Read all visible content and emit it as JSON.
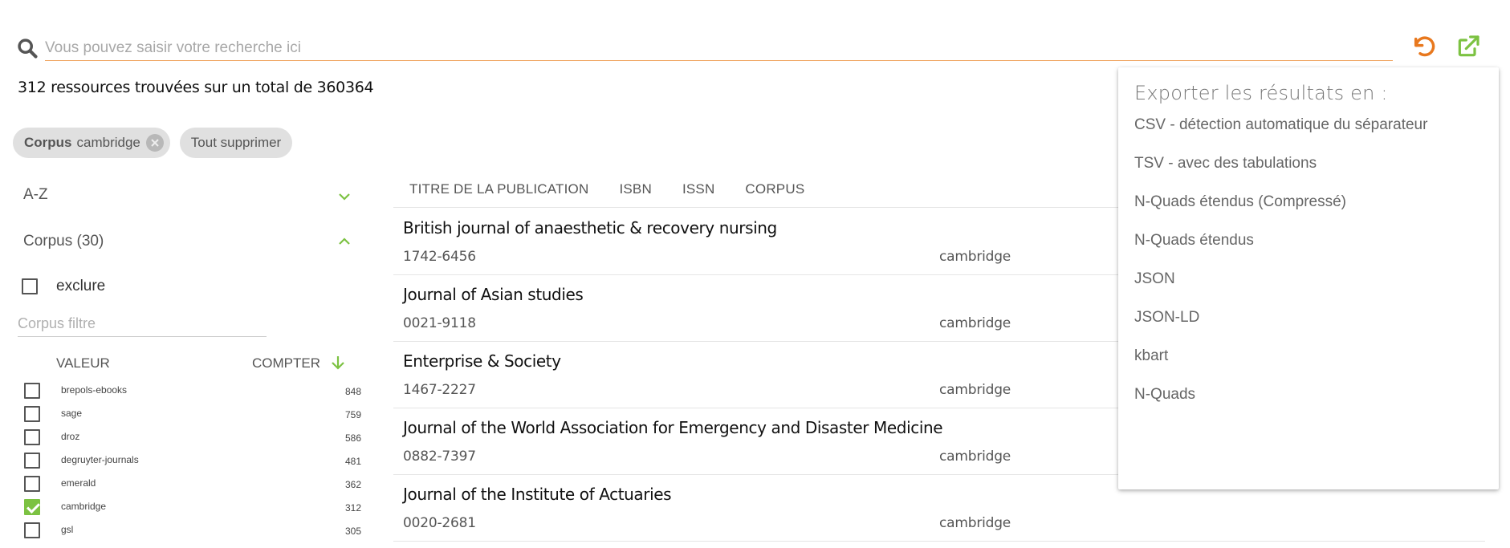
{
  "search": {
    "placeholder": "Vous pouvez saisir votre recherche ici",
    "value": ""
  },
  "results": {
    "count_text": "312 ressources trouvées sur un total de 360364"
  },
  "chips": {
    "corpus_key": "Corpus",
    "corpus_value": "cambridge",
    "clear_all": "Tout supprimer"
  },
  "facets": {
    "az_label": "A-Z",
    "corpus_label": "Corpus (30)",
    "exclude_label": "exclure",
    "filter_placeholder": "Corpus filtre",
    "col_value": "VALEUR",
    "col_count": "COMPTER",
    "items": [
      {
        "name": "brepols-ebooks",
        "count": "848",
        "checked": false
      },
      {
        "name": "sage",
        "count": "759",
        "checked": false
      },
      {
        "name": "droz",
        "count": "586",
        "checked": false
      },
      {
        "name": "degruyter-journals",
        "count": "481",
        "checked": false
      },
      {
        "name": "emerald",
        "count": "362",
        "checked": false
      },
      {
        "name": "cambridge",
        "count": "312",
        "checked": true
      },
      {
        "name": "gsl",
        "count": "305",
        "checked": false
      }
    ]
  },
  "table": {
    "headers": [
      "TITRE DE LA PUBLICATION",
      "ISBN",
      "ISSN",
      "CORPUS"
    ],
    "rows": [
      {
        "title": "British journal of anaesthetic & recovery nursing",
        "issn": "1742-6456",
        "corpus": "cambridge"
      },
      {
        "title": "Journal of Asian studies",
        "issn": "0021-9118",
        "corpus": "cambridge"
      },
      {
        "title": "Enterprise & Society",
        "issn": "1467-2227",
        "corpus": "cambridge"
      },
      {
        "title": "Journal of the World Association for Emergency and Disaster Medicine",
        "issn": "0882-7397",
        "corpus": "cambridge"
      },
      {
        "title": "Journal of the Institute of Actuaries",
        "issn": "0020-2681",
        "corpus": "cambridge"
      }
    ]
  },
  "export_menu": {
    "title": "Exporter les résultats en :",
    "items": [
      "CSV - détection automatique du séparateur",
      "TSV - avec des tabulations",
      "N-Quads étendus (Compressé)",
      "N-Quads étendus",
      "JSON",
      "JSON-LD",
      "kbart",
      "N-Quads"
    ]
  },
  "colors": {
    "accent_orange": "#e8781e",
    "accent_green": "#7cc242",
    "text_dark": "#111111",
    "text_muted": "#555555"
  },
  "icons": {
    "search": "search-icon",
    "reset": "undo-icon",
    "export": "external-link-icon"
  }
}
